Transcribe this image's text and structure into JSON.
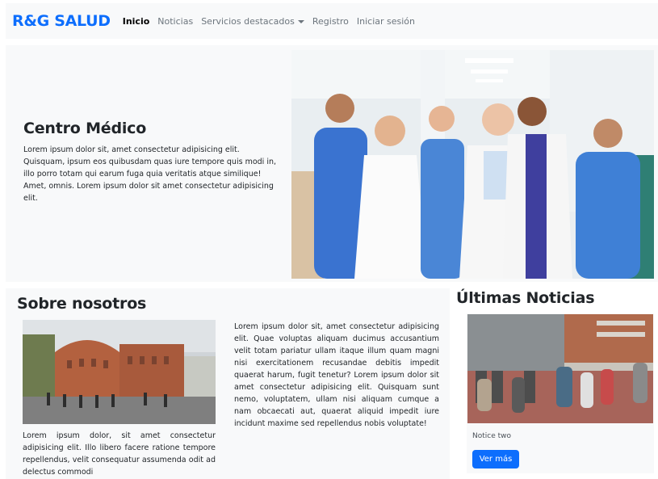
{
  "navbar": {
    "brand": "R&G SALUD",
    "links": [
      {
        "label": "Inicio"
      },
      {
        "label": "Noticias"
      },
      {
        "label": "Servicios destacados"
      },
      {
        "label": "Registro"
      },
      {
        "label": "Iniciar sesión"
      }
    ]
  },
  "hero": {
    "title": "Centro Médico",
    "body": "Lorem ipsum dolor sit, amet consectetur adipisicing elit. Quisquam, ipsum eos quibusdam quas iure tempore quis modi in, illo porro totam qui earum fuga quia veritatis atque similique! Amet, omnis. Lorem ipsum dolor sit amet consectetur adipisicing elit."
  },
  "about": {
    "title": "Sobre nosotros",
    "left_text": "Lorem ipsum dolor, sit amet consectetur adipisicing elit. Illo libero facere ratione tempore repellendus, velit consequatur assumenda odit ad delectus commodi",
    "right_text": "Lorem ipsum dolor sit, amet consectetur adipisicing elit. Quae voluptas aliquam ducimus accusantium velit totam pariatur ullam itaque illum quam magni nisi exercitationem recusandae debitis impedit quaerat harum, fugit tenetur? Lorem ipsum dolor sit amet consectetur adipisicing elit. Quisquam sunt nemo, voluptatem, ullam nisi aliquam cumque a nam obcaecati aut, quaerat aliquid impedit iure incidunt maxime sed repellendus nobis voluptate!"
  },
  "news": {
    "title": "Últimas Noticias",
    "caption": "Notice two",
    "button_label": "Ver más"
  },
  "colors": {
    "brand": "#0d6efd",
    "panel": "#f8f9fa"
  }
}
